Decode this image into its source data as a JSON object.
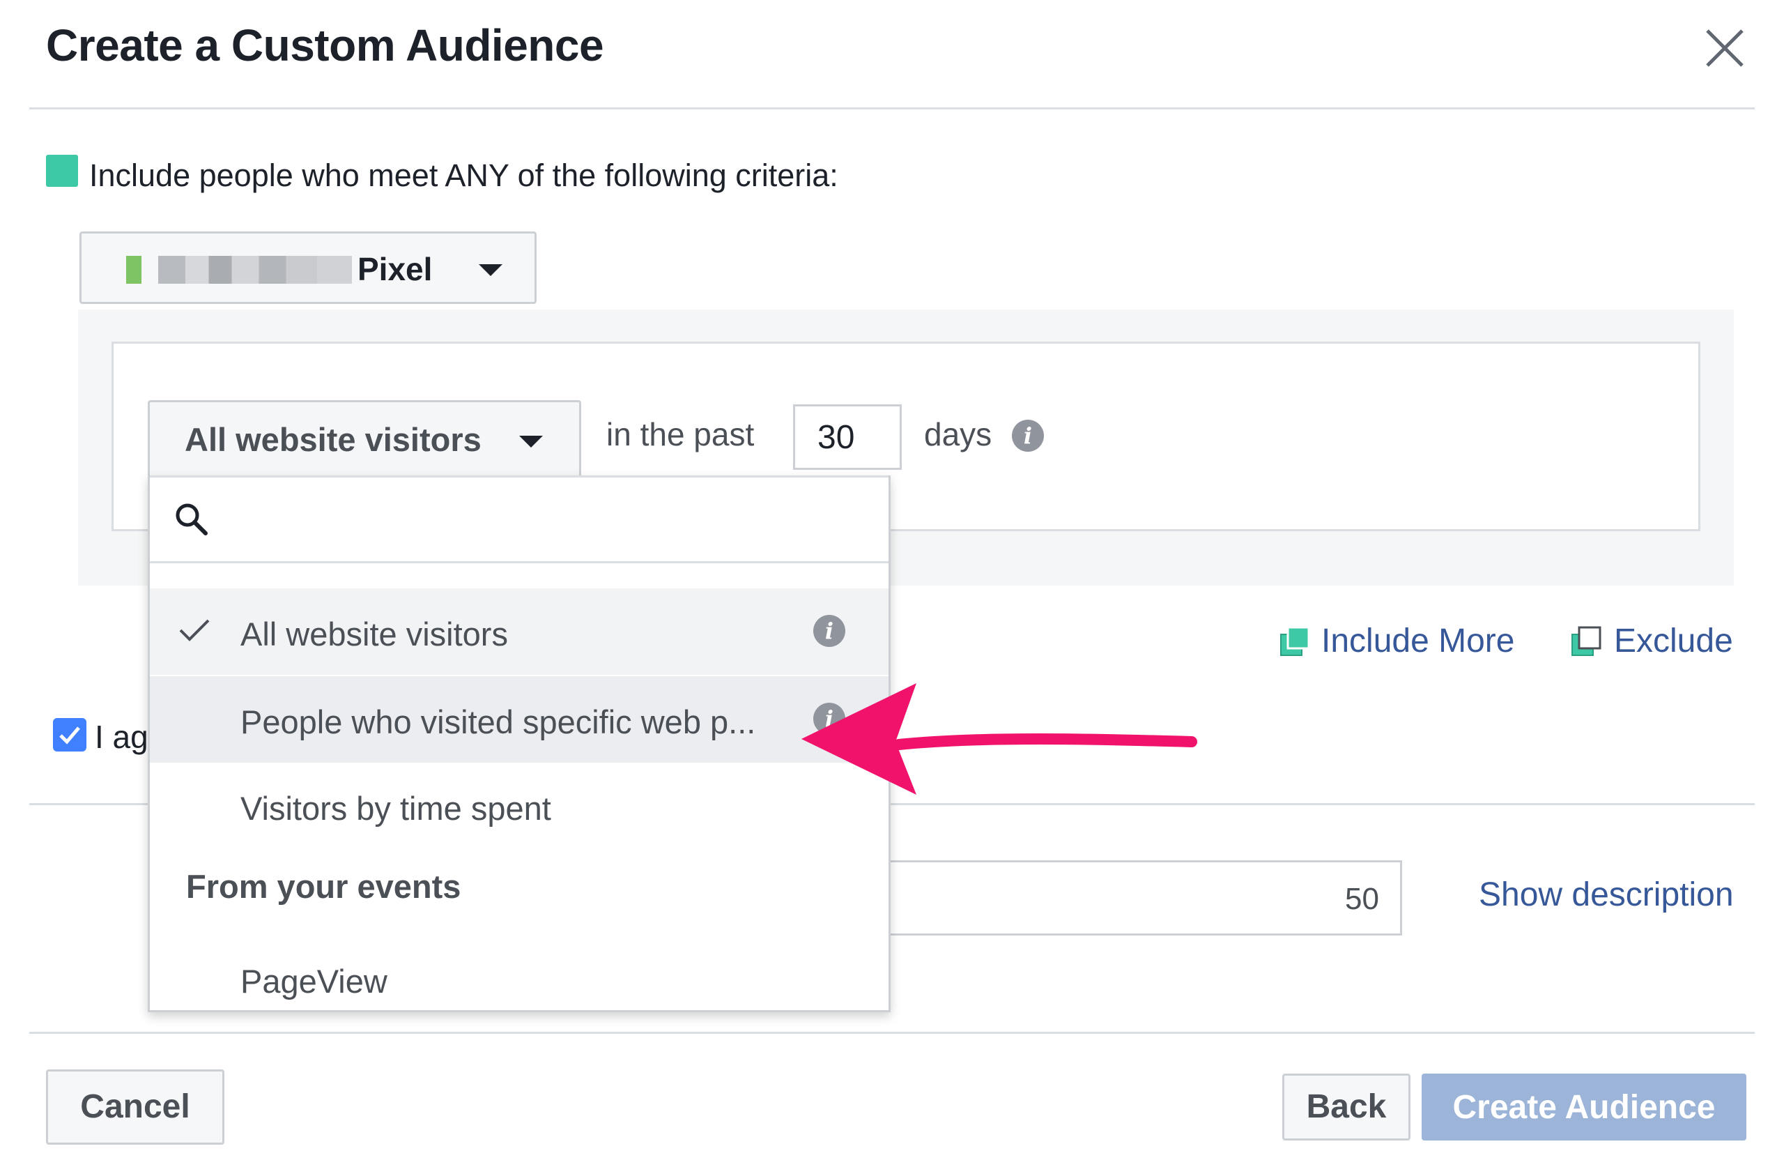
{
  "dialog": {
    "title": "Create a Custom Audience",
    "close_icon": "close-icon"
  },
  "criteria": {
    "text": "Include people who meet ANY of the following criteria:",
    "color": "#3ec9a6"
  },
  "pixel_select": {
    "label": "Pixel"
  },
  "rule": {
    "event_select": "All website visitors",
    "in_the_past": "in the past",
    "days_value": "30",
    "days_label": "days"
  },
  "dropdown": {
    "search_placeholder": "",
    "items": [
      {
        "label": "All website visitors",
        "selected": true
      },
      {
        "label": "People who visited specific web p...",
        "selected": false
      },
      {
        "label": "Visitors by time spent",
        "selected": false
      }
    ],
    "section_header": "From your events",
    "events": [
      {
        "label": "PageView"
      }
    ]
  },
  "actions": {
    "include_more": "Include More",
    "exclude": "Exclude"
  },
  "agree": {
    "text": "I ag",
    "checked": true
  },
  "audience_name": {
    "char_count": "50",
    "show_description": "Show description"
  },
  "footer": {
    "cancel": "Cancel",
    "back": "Back",
    "create": "Create Audience"
  },
  "colors": {
    "link": "#365899",
    "accent_arrow": "#f0126b",
    "primary_disabled": "#9cb4d8",
    "checkbox": "#4080ff"
  }
}
